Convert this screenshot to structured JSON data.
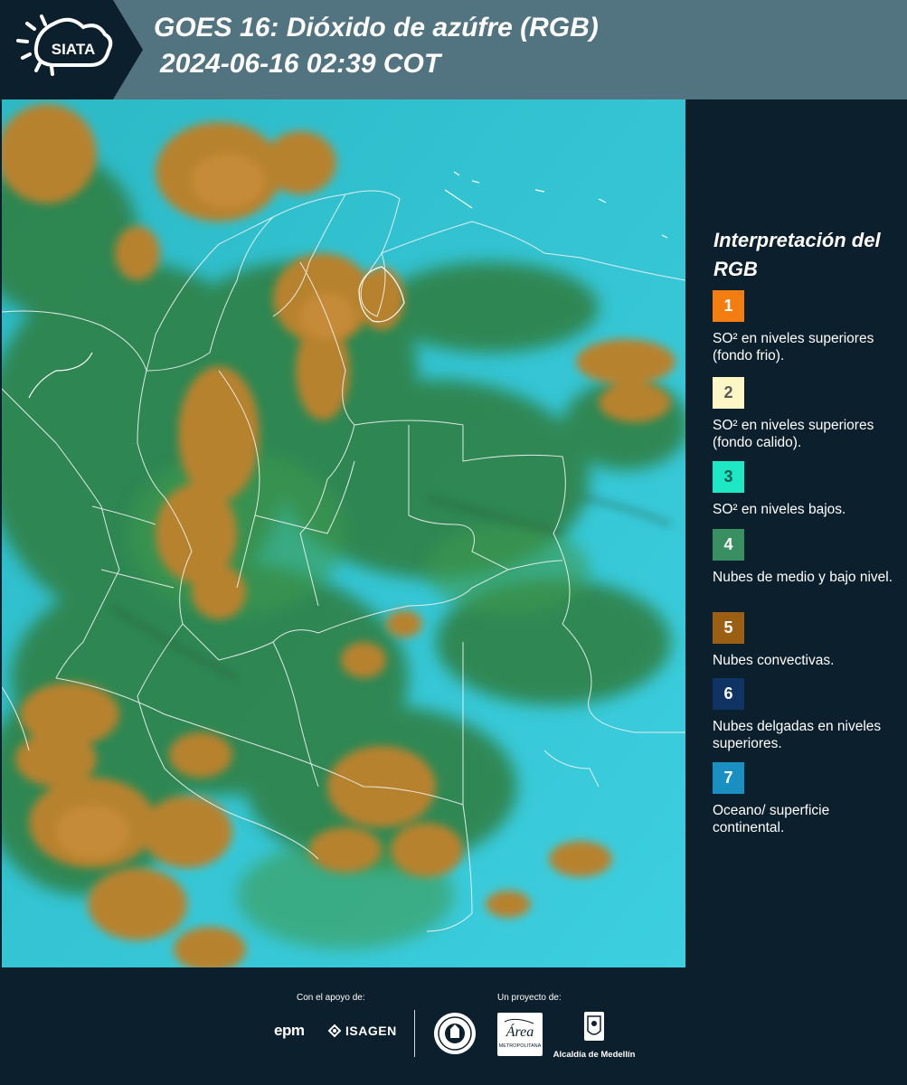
{
  "header": {
    "logo_text": "SIATA",
    "title_line1": "GOES 16: Dióxido de azúfre (RGB)",
    "title_line2": "2024-06-16 02:39 COT",
    "band_color": "#527380",
    "background_color": "#0c1f2c"
  },
  "map": {
    "product": "SO2 RGB composite",
    "colors": {
      "background": "#31c6d4",
      "midlevel_cloud": "#2c7a3a",
      "convective_cloud": "#b68032",
      "borders": "#f2f4f5"
    }
  },
  "legend": {
    "title": "Interpretación del RGB",
    "items": [
      {
        "number": "1",
        "label": "SO² en niveles superiores (fondo frio).",
        "color": "#f47d12",
        "text_color": "#ffffff"
      },
      {
        "number": "2",
        "label": "SO² en niveles superiores (fondo calido).",
        "color": "#fff6c6",
        "text_color": "#5a5a5a"
      },
      {
        "number": "3",
        "label": "SO² en niveles bajos.",
        "color": "#1ee8c3",
        "text_color": "#0c5c54"
      },
      {
        "number": "4",
        "label": "Nubes de medio y bajo nivel.",
        "color": "#3a8f62",
        "text_color": "#ffffff"
      },
      {
        "number": "5",
        "label": "Nubes convectivas.",
        "color": "#9a5f12",
        "text_color": "#ffffff"
      },
      {
        "number": "6",
        "label": "Nubes delgadas en niveles superiores.",
        "color": "#0f3464",
        "text_color": "#ffffff"
      },
      {
        "number": "7",
        "label": "Oceano/ superficie continental.",
        "color": "#1a8fc2",
        "text_color": "#ffffff"
      }
    ]
  },
  "footer": {
    "support_label": "Con el apoyo de:",
    "project_label": "Un proyecto de:",
    "epm_text": "epm",
    "isagen_text": "ISAGEN",
    "area_text": "Área",
    "area_subtext": "METROPOLITANA",
    "alcaldia_text": "Alcaldía de Medellín"
  }
}
